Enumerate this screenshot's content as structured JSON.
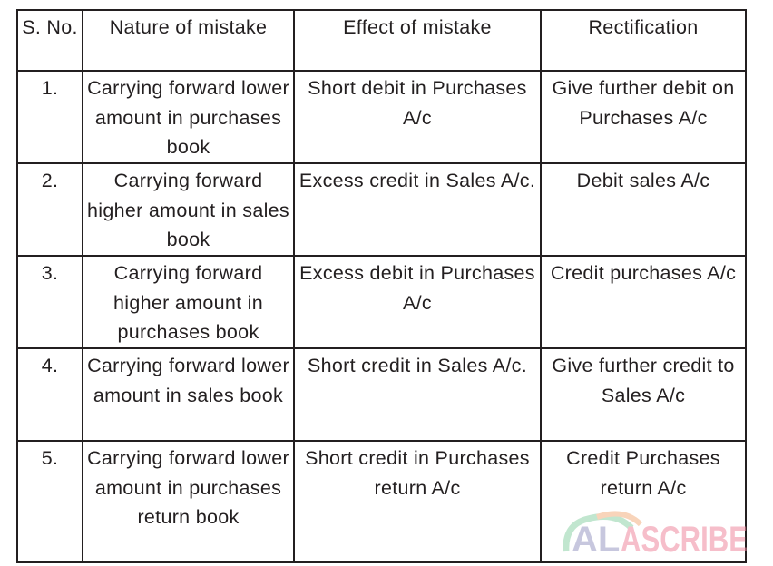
{
  "headers": [
    "S. No.",
    "Nature of mistake",
    "Effect of mistake",
    "Rectification"
  ],
  "rows": [
    [
      "1.",
      "Carrying forward lower amount in purchases book",
      "Short debit in Purchases A/c",
      "Give further debit on Purchases A/c"
    ],
    [
      "2.",
      "Carrying forward higher amount in sales book",
      "Excess credit in Sales A/c.",
      "Debit sales A/c"
    ],
    [
      "3.",
      "Carrying forward higher amount in purchases book",
      "Excess debit in Purchases A/c",
      "Credit purchases A/c"
    ],
    [
      "4.",
      "Carrying forward lower amount in sales book",
      "Short credit in Sales A/c.",
      "Give further credit to Sales A/c"
    ],
    [
      "5.",
      "Carrying forward lower amount in purchases return book",
      "Short credit in Purchases return A/c",
      "Credit Purchases return A/c"
    ]
  ],
  "watermark": "ALLSCRIBE"
}
